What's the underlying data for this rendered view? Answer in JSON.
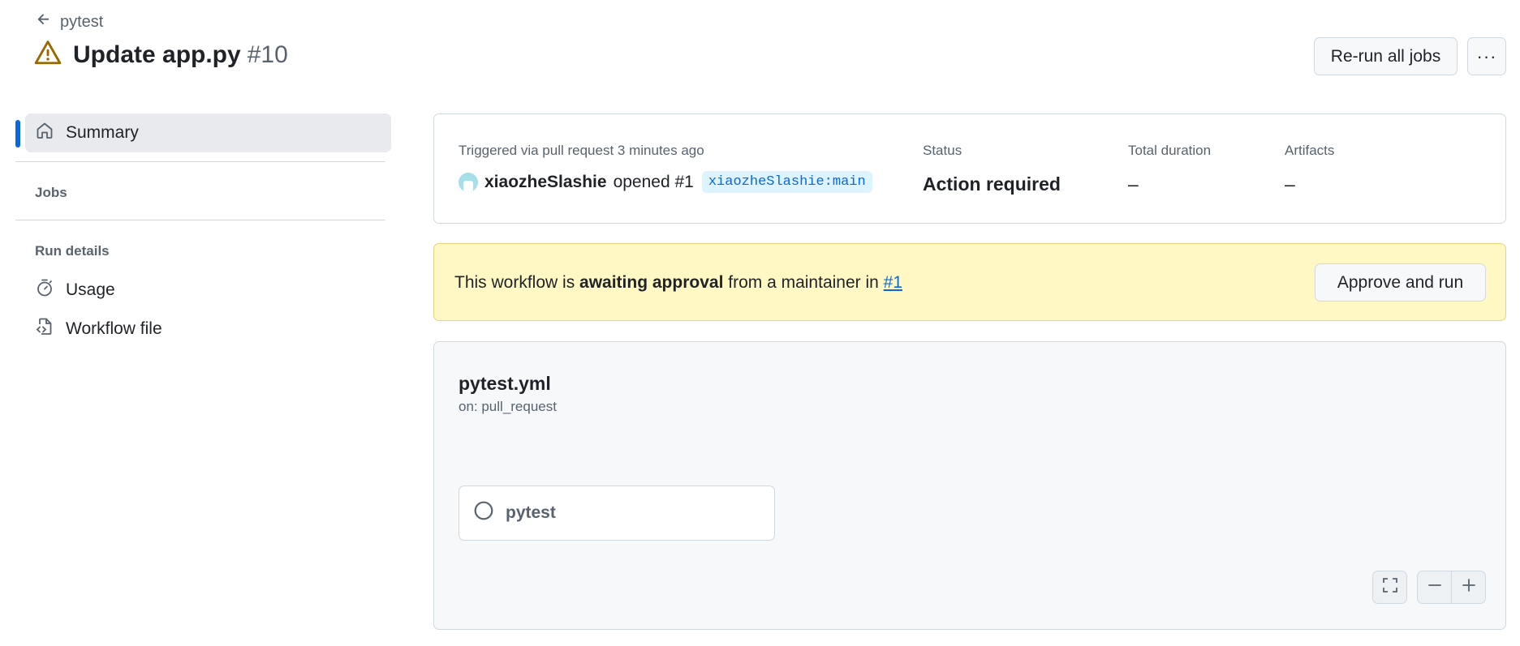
{
  "header": {
    "back_label": "pytest",
    "title": "Update app.py",
    "run_number": "#10",
    "rerun_label": "Re-run all jobs",
    "more_label": "···"
  },
  "sidebar": {
    "summary_label": "Summary",
    "jobs_heading": "Jobs",
    "run_details_heading": "Run details",
    "usage_label": "Usage",
    "workflow_file_label": "Workflow file"
  },
  "summary": {
    "trigger_text": "Triggered via pull request 3 minutes ago",
    "author": "xiaozheSlashie",
    "action_text": "opened #1",
    "branch": "xiaozheSlashie:main",
    "status_label": "Status",
    "status_value": "Action required",
    "duration_label": "Total duration",
    "duration_value": "–",
    "artifacts_label": "Artifacts",
    "artifacts_value": "–"
  },
  "banner": {
    "text_prefix": "This workflow is ",
    "text_bold": "awaiting approval",
    "text_middle": " from a maintainer in ",
    "link_text": "#1",
    "button_label": "Approve and run"
  },
  "workflow": {
    "file_name": "pytest.yml",
    "trigger": "on: pull_request",
    "job_name": "pytest"
  },
  "colors": {
    "accent": "#0969da",
    "warning": "#9a6700",
    "banner_bg": "#fff8c5"
  },
  "icons": {
    "back": "arrow-left-icon",
    "title_status": "alert-triangle-icon",
    "summary": "home-icon",
    "usage": "stopwatch-icon",
    "workflow_file": "file-code-icon",
    "job_status": "circle-pending-icon",
    "fit": "fullscreen-icon",
    "zoom_out": "minus-icon",
    "zoom_in": "plus-icon"
  }
}
